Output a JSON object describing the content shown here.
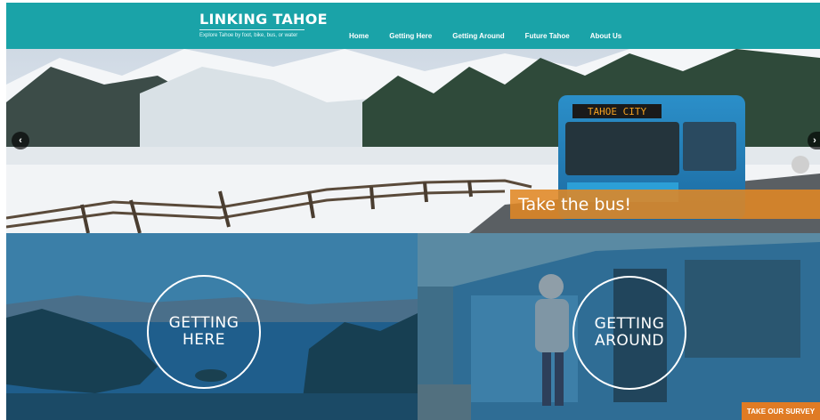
{
  "header": {
    "logo_title": "LINKING TAHOE",
    "logo_tagline": "Explore Tahoe by foot, bike, bus, or water",
    "nav": [
      "Home",
      "Getting Here",
      "Getting Around",
      "Future Tahoe",
      "About Us"
    ],
    "background_color": "#1aa3a8"
  },
  "hero": {
    "bus_sign": "TAHOE CITY",
    "caption": "Take the bus!",
    "caption_color": "#e08824",
    "prev_icon": "chevron-left-icon",
    "next_icon": "chevron-right-icon"
  },
  "panels": [
    {
      "line1": "GETTING",
      "line2": "HERE"
    },
    {
      "line1": "GETTING",
      "line2": "AROUND"
    }
  ],
  "survey_button": {
    "label": "TAKE OUR SURVEY",
    "color": "#e07b24"
  }
}
